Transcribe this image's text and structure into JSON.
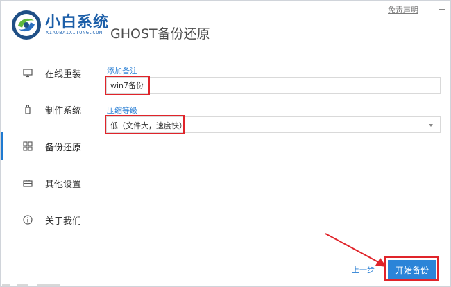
{
  "brand": {
    "name": "小白系统",
    "subtitle": "XIAOBAIXITONG.COM"
  },
  "page_title": "GHOST备份还原",
  "window": {
    "disclaimer": "免责声明"
  },
  "sidebar": {
    "items": [
      {
        "label": "在线重装",
        "icon": "monitor-icon",
        "active": false
      },
      {
        "label": "制作系统",
        "icon": "usb-icon",
        "active": false
      },
      {
        "label": "备份还原",
        "icon": "backup-grid-icon",
        "active": true
      },
      {
        "label": "其他设置",
        "icon": "briefcase-icon",
        "active": false
      },
      {
        "label": "关于我们",
        "icon": "info-icon",
        "active": false
      }
    ]
  },
  "form": {
    "note_label": "添加备注",
    "note_value": "win7备份",
    "level_label": "压缩等级",
    "level_value": "低（文件大，速度快）"
  },
  "footer": {
    "back_label": "上一步",
    "start_label": "开始备份"
  },
  "colors": {
    "accent": "#2b84d8",
    "brand": "#1b5ea8",
    "highlight": "#e0242a"
  }
}
